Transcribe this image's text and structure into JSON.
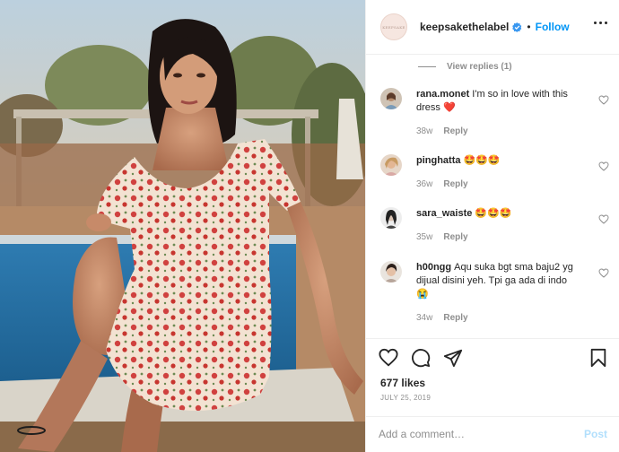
{
  "post": {
    "image_alt": "Woman in red floral dress sitting by a pool"
  },
  "header": {
    "avatar_text": "KEEPSAKE",
    "username": "keepsakethelabel",
    "verified_icon": "verified-badge-icon",
    "separator": "•",
    "follow_label": "Follow",
    "more_icon": "more-options-icon"
  },
  "thread": {
    "view_replies_label": "View replies (1)"
  },
  "comments": [
    {
      "user": "rana.monet",
      "text": "I'm so in love with this dress ❤️",
      "age": "38w",
      "reply_label": "Reply"
    },
    {
      "user": "pinghatta",
      "text": "🤩🤩🤩",
      "age": "36w",
      "reply_label": "Reply"
    },
    {
      "user": "sara_waiste",
      "text": "🤩🤩🤩",
      "age": "35w",
      "reply_label": "Reply"
    },
    {
      "user": "h00ngg",
      "text": "Aqu suka bgt sma baju2 yg dijual disini yeh. Tpi ga ada di indo😭",
      "age": "34w",
      "reply_label": "Reply"
    }
  ],
  "actions": {
    "likes": "677 likes",
    "date": "JULY 25, 2019",
    "comment_placeholder": "Add a comment…",
    "post_label": "Post"
  },
  "colors": {
    "accent": "#0095f6",
    "post_disabled": "#b2dffc",
    "muted": "#8e8e8e",
    "heart_red": "#ed4956"
  }
}
